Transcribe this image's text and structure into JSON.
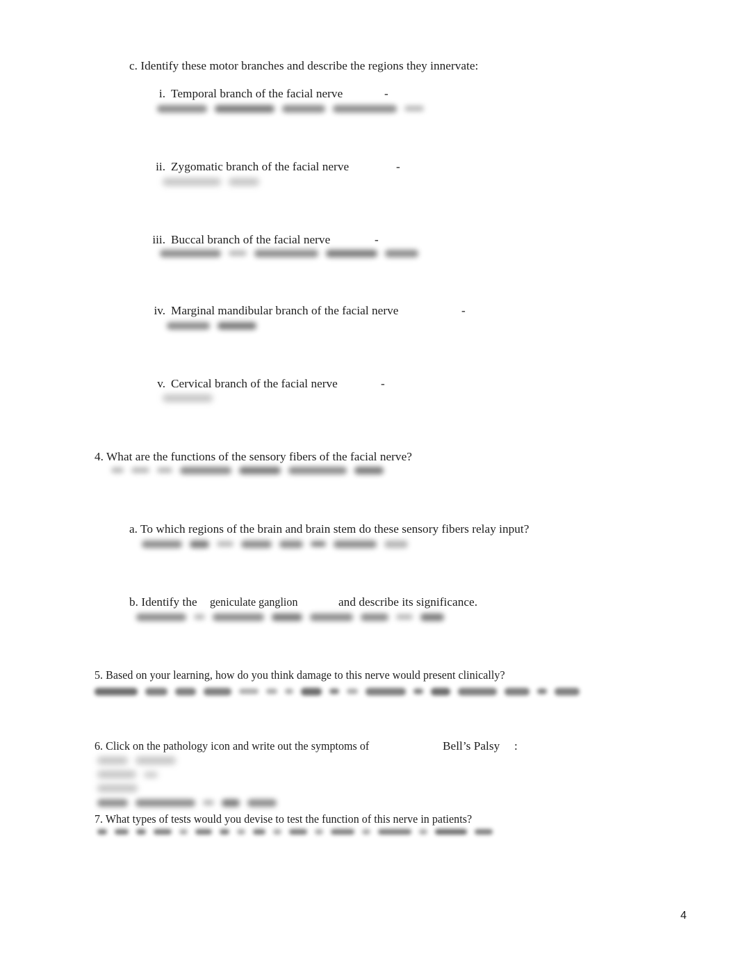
{
  "document": {
    "page_number": "4",
    "background_color": "#ffffff",
    "text_color": "#1d1d1d"
  },
  "sections": {
    "c": {
      "label": "c. Identify these motor branches and describe the regions they innervate:",
      "items": [
        {
          "numeral": "i.",
          "label": "Temporal branch of the facial nerve",
          "dash": "-"
        },
        {
          "numeral": "ii.",
          "label": "Zygomatic branch of the facial nerve",
          "dash": "-"
        },
        {
          "numeral": "iii.",
          "label": "Buccal branch of the facial nerve",
          "dash": "-"
        },
        {
          "numeral": "iv.",
          "label": "Marginal mandibular branch of the facial nerve",
          "dash": "-"
        },
        {
          "numeral": "v.",
          "label": "Cervical branch of the facial nerve",
          "dash": "-"
        }
      ]
    },
    "q4": {
      "label": "4. What are the functions of the sensory fibers of the facial nerve?",
      "sub_a": "a. To which regions of the brain and brain stem do these sensory fibers relay input?",
      "sub_b_prefix": "b. Identify the",
      "sub_b_term": "geniculate ganglion",
      "sub_b_suffix": "and describe its significance."
    },
    "q5": {
      "label": "5. Based on your learning, how do you think damage to this nerve would present clinically?"
    },
    "q6": {
      "prefix": "6. Click on the pathology icon and write out the symptoms of",
      "term": "Bell’s Palsy",
      "suffix": ":"
    },
    "q7": {
      "label": "7. What types of tests would you devise to test the function of this nerve in patients?"
    }
  },
  "handwritten_answers": {
    "note": "Handwritten student answers rendered blurred / illegible",
    "i": {
      "blob_widths": [
        72,
        86,
        62,
        92,
        28
      ]
    },
    "ii": {
      "blob_widths": [
        84,
        44
      ]
    },
    "iii": {
      "blob_widths": [
        88,
        26,
        92,
        74,
        48
      ]
    },
    "iv": {
      "blob_widths": [
        62,
        56
      ]
    },
    "v": {
      "blob_widths": [
        72
      ]
    },
    "q4": {
      "blob_widths": [
        18,
        26,
        22,
        74,
        60,
        84,
        42
      ]
    },
    "q4a": {
      "blob_widths": [
        58,
        28,
        24,
        44,
        34,
        22,
        62,
        34
      ]
    },
    "q4b": {
      "blob_widths": [
        72,
        16,
        74,
        44,
        62,
        40,
        24,
        34
      ]
    },
    "q5": {
      "blob_widths": [
        62,
        32,
        30,
        40,
        28,
        16,
        12,
        30,
        14,
        16,
        58,
        14,
        28,
        56,
        36,
        14,
        36
      ]
    },
    "q6_line1": {
      "blob_widths": [
        44,
        58
      ]
    },
    "q6_line2": {
      "blob_widths": [
        56,
        20
      ]
    },
    "q6_line3": {
      "blob_widths": [
        58
      ]
    },
    "q6_line4": {
      "blob_widths": [
        44,
        86,
        16,
        26,
        42
      ]
    },
    "q7": {
      "blob_widths": [
        14,
        20,
        14,
        26,
        12,
        24,
        14,
        12,
        18,
        12,
        26,
        12,
        34,
        12,
        48,
        12,
        46,
        26
      ]
    }
  }
}
